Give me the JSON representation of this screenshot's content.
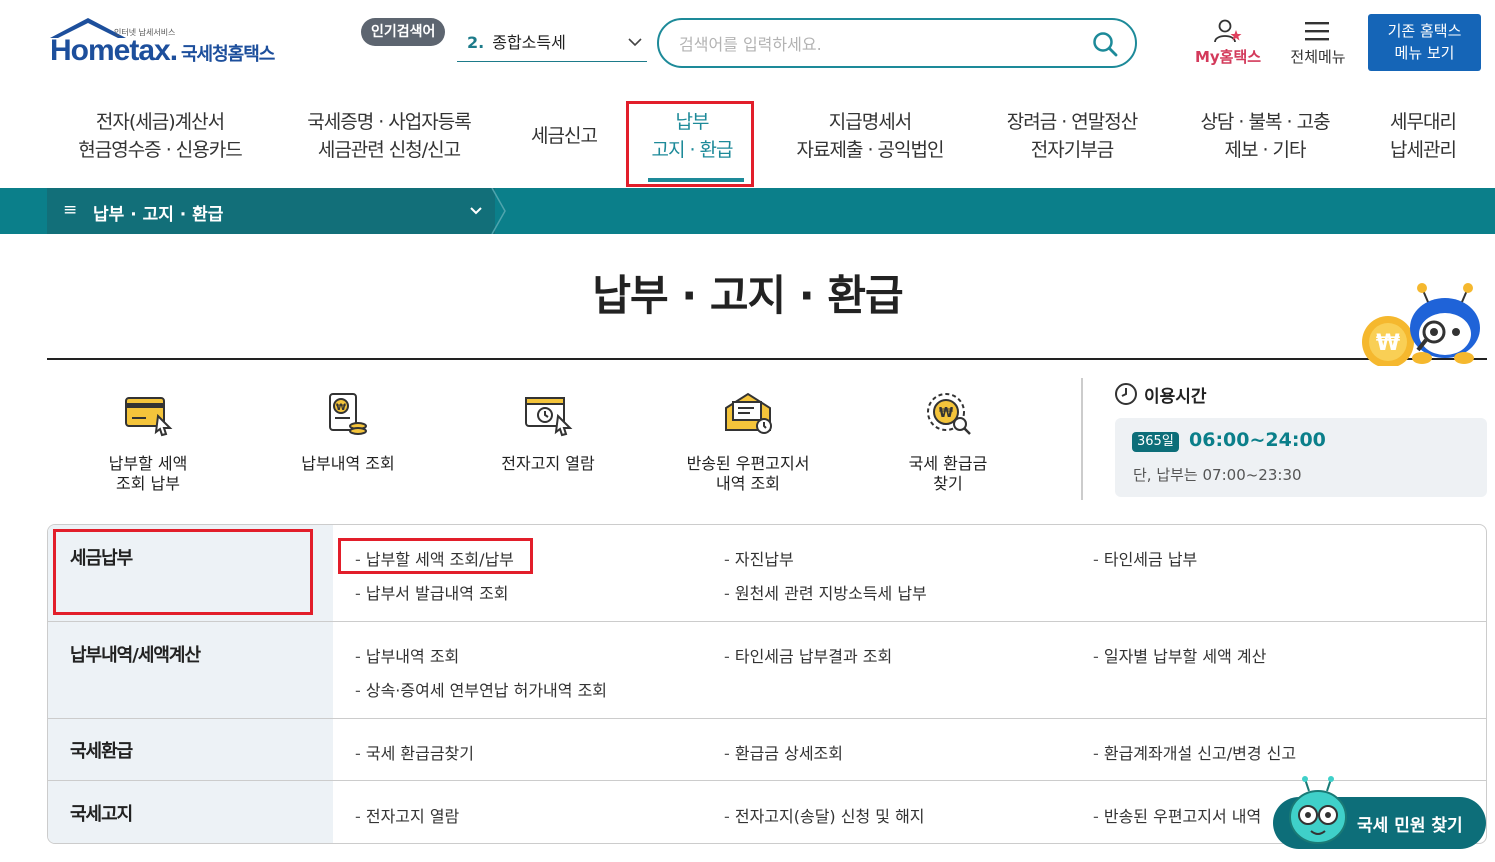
{
  "header": {
    "logo": {
      "small_text": "인터넷 납세서비스",
      "main_text": "Hometax.",
      "sub_text": "국세청홈택스"
    },
    "popular_label": "인기검색어",
    "popular_rank": "2.",
    "popular_term": "종합소득세",
    "search_placeholder": "검색어를 입력하세요.",
    "my_label": "My홈택스",
    "menu_label": "전체메뉴",
    "old_menu_line1": "기존 홈택스",
    "old_menu_line2": "메뉴 보기"
  },
  "gnb": [
    {
      "line1": "전자(세금)계산서",
      "line2": "현금영수증 · 신용카드"
    },
    {
      "line1": "국세증명 · 사업자등록",
      "line2": "세금관련 신청/신고"
    },
    {
      "line1": "세금신고",
      "line2": ""
    },
    {
      "line1": "납부",
      "line2": "고지 · 환급"
    },
    {
      "line1": "지급명세서",
      "line2": "자료제출 · 공익법인"
    },
    {
      "line1": "장려금 · 연말정산",
      "line2": "전자기부금"
    },
    {
      "line1": "상담 · 불복 · 고충",
      "line2": "제보 · 기타"
    },
    {
      "line1": "세무대리",
      "line2": "납세관리"
    }
  ],
  "lnb": {
    "label": "납부 · 고지 · 환급"
  },
  "page_title": "납부 · 고지 · 환급",
  "quick_menu": [
    {
      "line1": "납부할 세액",
      "line2": "조회 납부",
      "icon": "card-icon"
    },
    {
      "line1": "납부내역 조회",
      "line2": "",
      "icon": "receipt-icon"
    },
    {
      "line1": "전자고지 열람",
      "line2": "",
      "icon": "clock-mail-icon"
    },
    {
      "line1": "반송된 우편고지서",
      "line2": "내역 조회",
      "icon": "envelope-icon"
    },
    {
      "line1": "국세 환급금",
      "line2": "찾기",
      "icon": "refund-search-icon"
    }
  ],
  "hours": {
    "title": "이용시간",
    "badge": "365일",
    "time": "06:00~24:00",
    "note": "단, 납부는 07:00~23:30"
  },
  "menu_rows": [
    {
      "title": "세금납부",
      "links": [
        "납부할 세액 조회/납부",
        "자진납부",
        "타인세금 납부",
        "납부서 발급내역 조회",
        "원천세 관련 지방소득세 납부"
      ]
    },
    {
      "title": "납부내역/세액계산",
      "links": [
        "납부내역 조회",
        "타인세금 납부결과 조회",
        "일자별 납부할 세액 계산",
        "상속·증여세 연부연납 허가내역 조회"
      ]
    },
    {
      "title": "국세환급",
      "links": [
        "국세 환급금찾기",
        "환급금 상세조회",
        "환급계좌개설 신고/변경 신고"
      ]
    },
    {
      "title": "국세고지",
      "links": [
        "전자고지 열람",
        "전자고지(송달) 신청 및 해지",
        "반송된 우편고지서 내역"
      ]
    }
  ],
  "float_button": "국세 민원 찾기",
  "colors": {
    "accent": "#0b7f8a",
    "highlight": "#e21e2a",
    "brand": "#1d4f9c"
  }
}
